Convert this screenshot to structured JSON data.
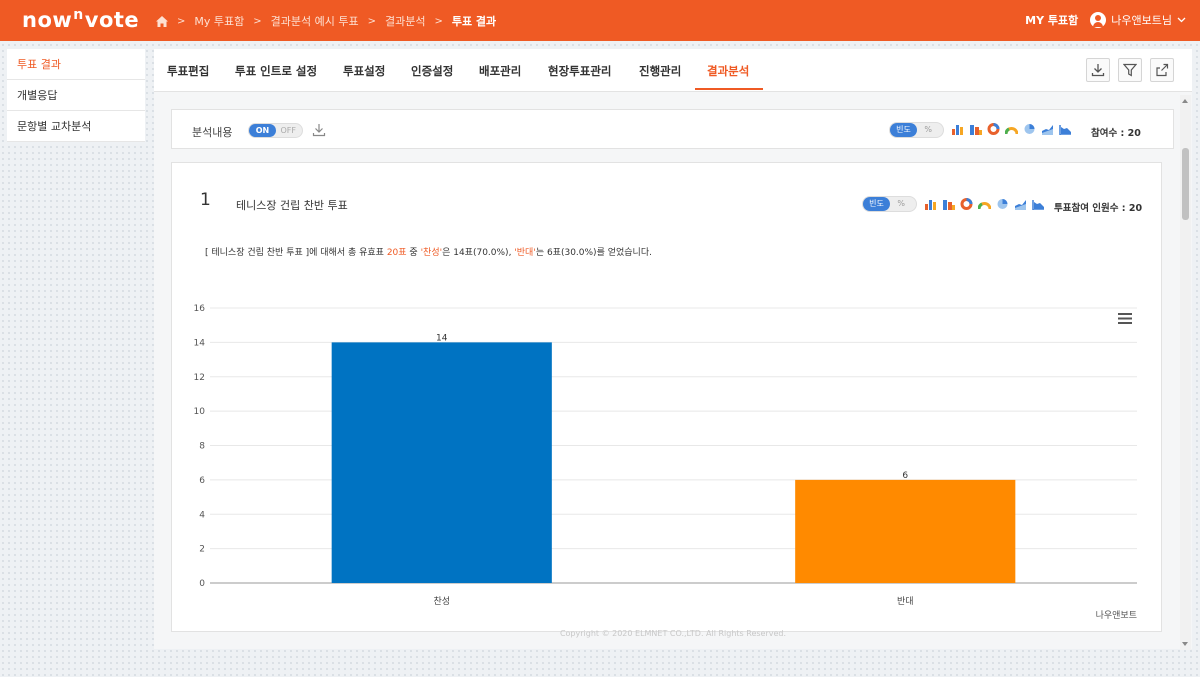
{
  "header": {
    "logo_pre": "now",
    "logo_sup": "n",
    "logo_post": "vote",
    "breadcrumb": [
      "My 투표함",
      "결과분석 예시 투표",
      "결과분석"
    ],
    "breadcrumb_current": "투표 결과",
    "my_box": "MY 투표함",
    "user_name": "나우앤보트님"
  },
  "sidebar": {
    "items": [
      {
        "label": "투표 결과"
      },
      {
        "label": "개별응답"
      },
      {
        "label": "문항별 교차분석"
      }
    ]
  },
  "tabs": [
    {
      "label": "투표편집"
    },
    {
      "label": "투표 인트로 설정"
    },
    {
      "label": "투표설정"
    },
    {
      "label": "인증설정"
    },
    {
      "label": "배포관리"
    },
    {
      "label": "현장투표관리"
    },
    {
      "label": "진행관리"
    },
    {
      "label": "결과분석"
    }
  ],
  "analysis_bar": {
    "label": "분석내용",
    "toggle_on": "ON",
    "toggle_off": "OFF",
    "seg_freq": "빈도",
    "seg_pct": "%",
    "participants": "참여수 : 20"
  },
  "question": {
    "number": "1",
    "title": "테니스장 건립 찬반 투표",
    "seg_freq": "빈도",
    "seg_pct": "%",
    "participants": "투표참여 인원수 : 20",
    "summary_parts": [
      {
        "text": "[ 테니스장 건립 찬반 투표 ]에 대해서 총 유효표 ",
        "hl": false
      },
      {
        "text": "20표",
        "hl": true
      },
      {
        "text": " 중 ",
        "hl": false
      },
      {
        "text": "'찬성'",
        "hl": true
      },
      {
        "text": "은 14표(70.0%), ",
        "hl": false
      },
      {
        "text": "'반대'",
        "hl": true
      },
      {
        "text": "는 6표(30.0%)",
        "hl": false
      },
      {
        "text": "를 얻었습니다.",
        "hl": false
      }
    ],
    "credit": "나우앤보트"
  },
  "chart_data": {
    "type": "bar",
    "categories": [
      "찬성",
      "반대"
    ],
    "values": [
      14,
      6
    ],
    "colors": [
      "#0073c2",
      "#ff8a00"
    ],
    "ylim": [
      0,
      16
    ],
    "yticks": [
      0,
      2,
      4,
      6,
      8,
      10,
      12,
      14,
      16
    ],
    "title": "",
    "xlabel": "",
    "ylabel": ""
  },
  "footer": "Copyright © 2020 ELMNET CO.,LTD. All Rights Reserved."
}
